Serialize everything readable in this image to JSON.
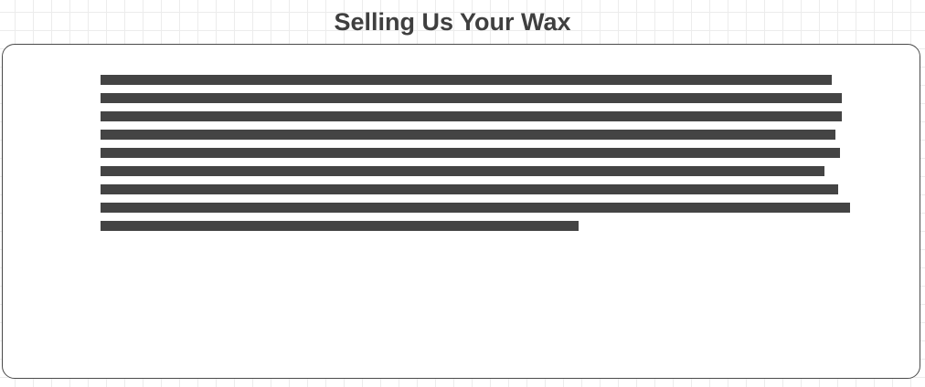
{
  "page": {
    "title": "Selling Us Your Wax"
  },
  "panel": {
    "placeholder_line_fill": [
      0.976,
      0.989,
      0.989,
      0.98,
      0.986,
      0.966,
      0.984,
      1.0,
      0.638
    ]
  },
  "colors": {
    "title": "#3f3f3f",
    "placeholder_line": "#444444",
    "panel_border": "#4a4a4a",
    "grid": "#ececec",
    "background": "#ffffff"
  }
}
